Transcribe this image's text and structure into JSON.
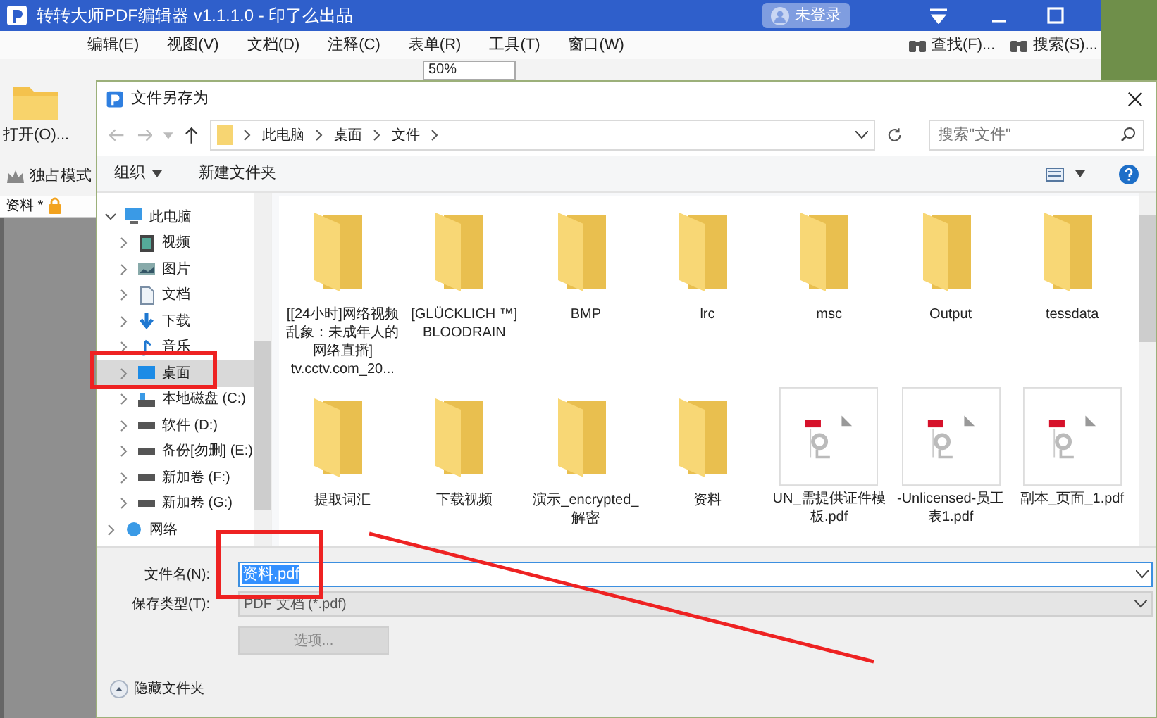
{
  "app": {
    "title": "转转大师PDF编辑器 v1.1.1.0 - 印了么出品",
    "user_label": "未登录",
    "menu": [
      "编辑(E)",
      "视图(V)",
      "文档(D)",
      "注释(C)",
      "表单(R)",
      "工具(T)",
      "窗口(W)"
    ],
    "search_tools": [
      "查找(F)...",
      "搜索(S)..."
    ],
    "zoom": "50%",
    "open_label": "打开(O)...",
    "mode_label": "独占模式",
    "doc_tab": {
      "label": "资料 *",
      "locked": true
    }
  },
  "dialog": {
    "title": "文件另存为",
    "breadcrumb": [
      "此电脑",
      "桌面",
      "文件"
    ],
    "search": {
      "placeholder": "搜索\"文件\""
    },
    "toolbar": [
      "组织",
      "新建文件夹"
    ],
    "nav": [
      {
        "label": "此电脑",
        "kind": "pc",
        "expanded": true,
        "selected": false,
        "children": [
          {
            "label": "视频",
            "kind": "video",
            "selected": false
          },
          {
            "label": "图片",
            "kind": "picture",
            "selected": false
          },
          {
            "label": "文档",
            "kind": "doc",
            "selected": false
          },
          {
            "label": "下载",
            "kind": "download",
            "selected": false
          },
          {
            "label": "音乐",
            "kind": "music",
            "selected": false
          },
          {
            "label": "桌面",
            "kind": "desktop",
            "selected": true
          },
          {
            "label": "本地磁盘 (C:)",
            "kind": "system-drive",
            "selected": false
          },
          {
            "label": "软件 (D:)",
            "kind": "drive",
            "selected": false
          },
          {
            "label": "备份[勿删] (E:)",
            "kind": "drive",
            "selected": false
          },
          {
            "label": "新加卷 (F:)",
            "kind": "drive",
            "selected": false
          },
          {
            "label": "新加卷 (G:)",
            "kind": "drive",
            "selected": false
          }
        ]
      },
      {
        "label": "网络",
        "kind": "network",
        "expanded": false,
        "selected": false
      }
    ],
    "items": [
      {
        "name": "[[24小时]网络视频乱象：未成年人的网络直播] tv.cctv.com_20...",
        "kind": "folder"
      },
      {
        "name": "[GLÜCKLICH ™] BLOODRAIN",
        "kind": "folder"
      },
      {
        "name": "BMP",
        "kind": "folder"
      },
      {
        "name": "lrc",
        "kind": "folder"
      },
      {
        "name": "msc",
        "kind": "folder"
      },
      {
        "name": "Output",
        "kind": "folder"
      },
      {
        "name": "tessdata",
        "kind": "folder"
      },
      {
        "name": "提取词汇",
        "kind": "folder"
      },
      {
        "name": "下载视频",
        "kind": "folder"
      },
      {
        "name": "演示_encrypted_解密",
        "kind": "folder"
      },
      {
        "name": "资料",
        "kind": "folder"
      },
      {
        "name": "UN_需提供证件模板.pdf",
        "kind": "pdf"
      },
      {
        "name": "-Unlicensed-员工表1.pdf",
        "kind": "pdf"
      },
      {
        "name": "副本_页面_1.pdf",
        "kind": "pdf"
      }
    ],
    "filename": {
      "label": "文件名(N):",
      "value": "资料.pdf"
    },
    "filetype": {
      "label": "保存类型(T):",
      "value": "PDF 文档 (*.pdf)"
    },
    "options_button": {
      "label": "选项...",
      "disabled": true
    },
    "hide_folders": "隐藏文件夹"
  }
}
